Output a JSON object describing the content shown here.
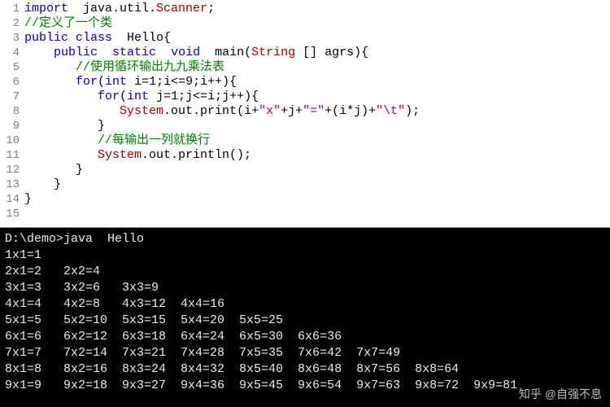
{
  "editor": {
    "line_numbers": [
      "1",
      "2",
      "3",
      "4",
      "5",
      "6",
      "7",
      "8",
      "9",
      "10",
      "11",
      "12",
      "13",
      "14",
      "15"
    ],
    "tokens": [
      [
        {
          "t": "import",
          "c": "kw"
        },
        {
          "t": "  ",
          "c": "pln"
        },
        {
          "t": "java.util.",
          "c": "pln"
        },
        {
          "t": "Scanner",
          "c": "cls"
        },
        {
          "t": ";",
          "c": "pln"
        }
      ],
      [
        {
          "t": "//定义了一个类",
          "c": "cmt"
        }
      ],
      [
        {
          "t": "public class",
          "c": "kw"
        },
        {
          "t": "  Hello{",
          "c": "pln"
        }
      ],
      [
        {
          "t": "    ",
          "c": "pln"
        },
        {
          "t": "public",
          "c": "kw"
        },
        {
          "t": "  ",
          "c": "pln"
        },
        {
          "t": "static",
          "c": "kw"
        },
        {
          "t": "  ",
          "c": "pln"
        },
        {
          "t": "void",
          "c": "kw"
        },
        {
          "t": "  main(",
          "c": "pln"
        },
        {
          "t": "String",
          "c": "cls"
        },
        {
          "t": " [] agrs){",
          "c": "pln"
        }
      ],
      [
        {
          "t": "       ",
          "c": "pln"
        },
        {
          "t": "//使用循环输出九九乘法表",
          "c": "cmt"
        }
      ],
      [
        {
          "t": "       ",
          "c": "pln"
        },
        {
          "t": "for",
          "c": "kw"
        },
        {
          "t": "(",
          "c": "pln"
        },
        {
          "t": "int",
          "c": "kw"
        },
        {
          "t": " i=1;i<=9;i++){",
          "c": "pln"
        }
      ],
      [
        {
          "t": "          ",
          "c": "pln"
        },
        {
          "t": "for",
          "c": "kw"
        },
        {
          "t": "(",
          "c": "pln"
        },
        {
          "t": "int",
          "c": "kw"
        },
        {
          "t": " j=1;j<=i;j++){",
          "c": "pln"
        }
      ],
      [
        {
          "t": "             ",
          "c": "pln"
        },
        {
          "t": "System",
          "c": "cls"
        },
        {
          "t": ".out.print(i+",
          "c": "pln"
        },
        {
          "t": "\"x\"",
          "c": "str"
        },
        {
          "t": "+j+",
          "c": "pln"
        },
        {
          "t": "\"=\"",
          "c": "str"
        },
        {
          "t": "+(i*j)+",
          "c": "pln"
        },
        {
          "t": "\"\\t\"",
          "c": "str"
        },
        {
          "t": ");",
          "c": "pln"
        }
      ],
      [
        {
          "t": "          }",
          "c": "pln"
        }
      ],
      [
        {
          "t": "          ",
          "c": "pln"
        },
        {
          "t": "//每输出一列就换行",
          "c": "cmt"
        }
      ],
      [
        {
          "t": "          ",
          "c": "pln"
        },
        {
          "t": "System",
          "c": "cls"
        },
        {
          "t": ".out.println();",
          "c": "pln"
        }
      ],
      [
        {
          "t": "       }",
          "c": "pln"
        }
      ],
      [
        {
          "t": "    }",
          "c": "pln"
        }
      ],
      [
        {
          "t": "}",
          "c": "pln"
        }
      ],
      [
        {
          "t": "",
          "c": "pln"
        }
      ]
    ]
  },
  "terminal": {
    "prompt": "D:\\demo>java  Hello",
    "rows": [
      "1x1=1",
      "2x1=2   2x2=4",
      "3x1=3   3x2=6   3x3=9",
      "4x1=4   4x2=8   4x3=12  4x4=16",
      "5x1=5   5x2=10  5x3=15  5x4=20  5x5=25",
      "6x1=6   6x2=12  6x3=18  6x4=24  6x5=30  6x6=36",
      "7x1=7   7x2=14  7x3=21  7x4=28  7x5=35  7x6=42  7x7=49",
      "8x1=8   8x2=16  8x3=24  8x4=32  8x5=40  8x6=48  8x7=56  8x8=64",
      "9x1=9   9x2=18  9x3=27  9x4=36  9x5=45  9x6=54  9x7=63  9x8=72  9x9=81"
    ]
  },
  "watermark": "知乎 @自强不息"
}
